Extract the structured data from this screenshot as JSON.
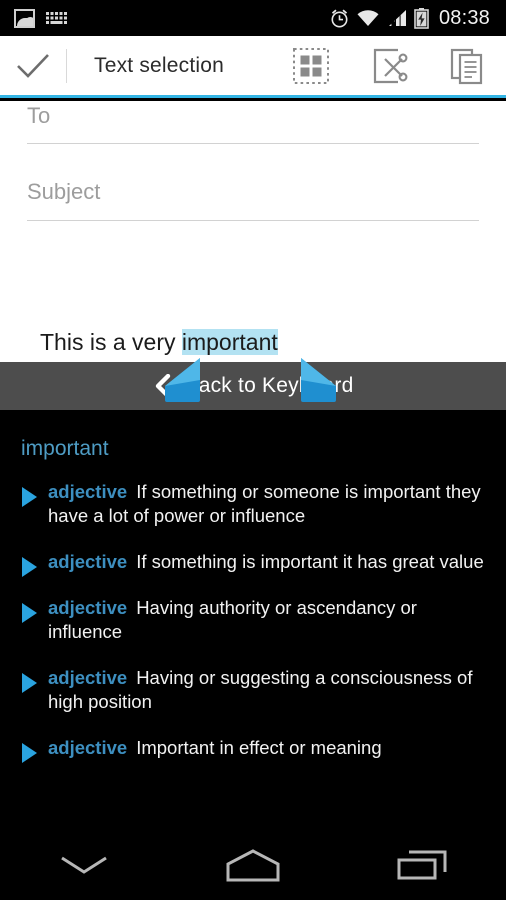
{
  "statusbar": {
    "icons_left": [
      "gallery-icon",
      "keyboard-icon"
    ],
    "icons_right": [
      "alarm-icon",
      "wifi-icon",
      "signal-icon",
      "battery-charging-icon"
    ],
    "time": "08:38"
  },
  "actionbar": {
    "done_icon": "checkmark-icon",
    "title": "Text selection",
    "actions": [
      {
        "name": "select-all-icon",
        "label": "Select all"
      },
      {
        "name": "cut-icon",
        "label": "Cut"
      },
      {
        "name": "copy-icon",
        "label": "Copy"
      }
    ],
    "accent_color": "#33b5e5"
  },
  "compose": {
    "to_placeholder": "To",
    "subject_placeholder": "Subject",
    "body_prefix": "This is a very ",
    "body_selected": "important",
    "selection_highlight_color": "#b3e2f2"
  },
  "keyboard_bar": {
    "back_icon": "chevron-left-icon",
    "label": "Back to Keyboard",
    "background_color": "#4d4d4d"
  },
  "selection": {
    "left_handle": "selection-handle-left",
    "right_handle": "selection-handle-right",
    "handle_color": "#2f9bd7"
  },
  "dictionary": {
    "word": "important",
    "word_color": "#4e9cc4",
    "entries": [
      {
        "pos": "adjective",
        "definition": "If something or someone is important they have a lot of power or influence"
      },
      {
        "pos": "adjective",
        "definition": "If something is important it has great value"
      },
      {
        "pos": "adjective",
        "definition": "Having authority or ascendancy or influence"
      },
      {
        "pos": "adjective",
        "definition": "Having or suggesting a consciousness of high position"
      },
      {
        "pos": "adjective",
        "definition": "Important in effect or meaning"
      }
    ]
  },
  "navbar": {
    "buttons": [
      {
        "name": "hide-keyboard-icon",
        "label": "Hide keyboard"
      },
      {
        "name": "home-icon",
        "label": "Home"
      },
      {
        "name": "recents-icon",
        "label": "Recents"
      }
    ]
  }
}
